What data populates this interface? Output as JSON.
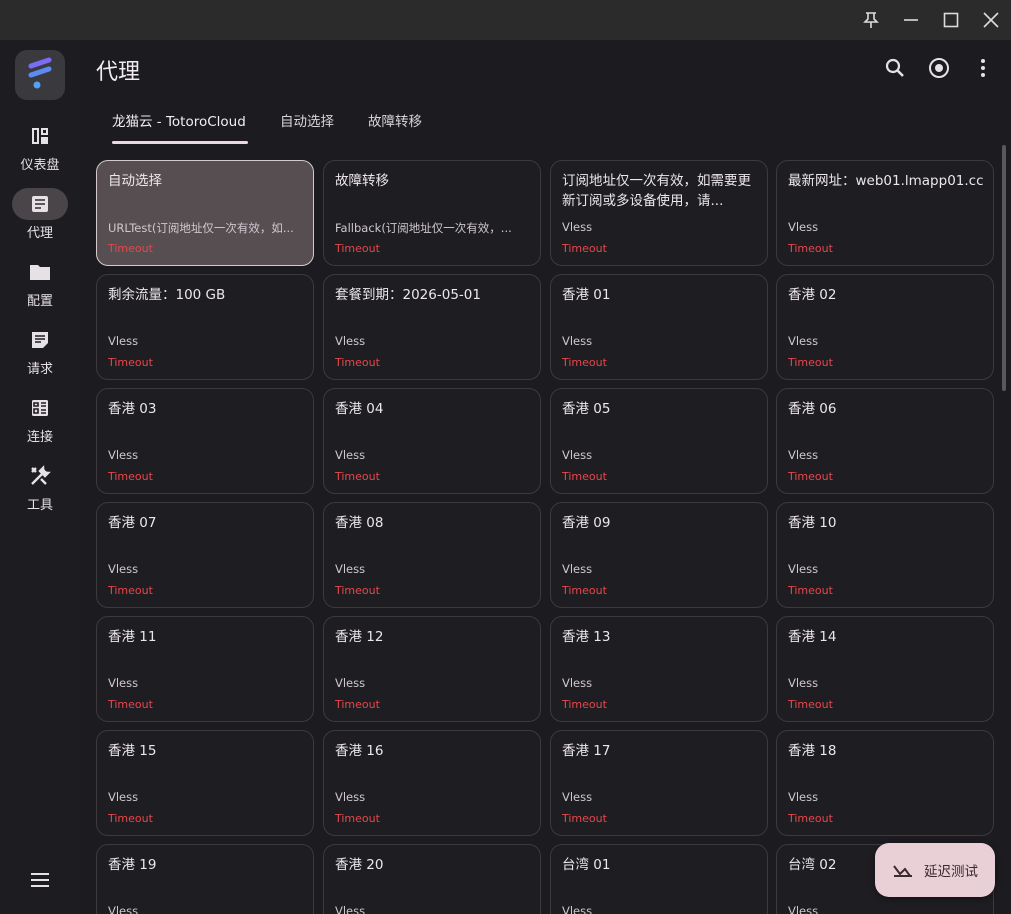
{
  "window": {
    "pin_icon": "pin-icon",
    "minimize_icon": "minimize-icon",
    "maximize_icon": "maximize-icon",
    "close_icon": "close-icon"
  },
  "rail": {
    "items": [
      {
        "label": "仪表盘",
        "icon": "dashboard-icon",
        "active": false
      },
      {
        "label": "代理",
        "icon": "proxy-icon",
        "active": true
      },
      {
        "label": "配置",
        "icon": "folder-icon",
        "active": false
      },
      {
        "label": "请求",
        "icon": "request-icon",
        "active": false
      },
      {
        "label": "连接",
        "icon": "connection-icon",
        "active": false
      },
      {
        "label": "工具",
        "icon": "tools-icon",
        "active": false
      }
    ],
    "menu_icon": "menu-icon"
  },
  "header": {
    "title": "代理",
    "icons": [
      "search-icon",
      "target-icon",
      "more-vert-icon"
    ]
  },
  "tabs": [
    {
      "label": "龙猫云 - TotoroCloud",
      "active": true
    },
    {
      "label": "自动选择",
      "active": false
    },
    {
      "label": "故障转移",
      "active": false
    }
  ],
  "cards": [
    {
      "name": "自动选择",
      "type": "URLTest(订阅地址仅一次有效，如...",
      "delay": "Timeout",
      "selected": true
    },
    {
      "name": "故障转移",
      "type": "Fallback(订阅地址仅一次有效，...",
      "delay": "Timeout"
    },
    {
      "name": "订阅地址仅一次有效，如需要更新订阅或多设备使用，请...",
      "type": "Vless",
      "delay": "Timeout"
    },
    {
      "name": "最新网址：web01.lmapp01.cc",
      "type": "Vless",
      "delay": "Timeout"
    },
    {
      "name": "剩余流量：100 GB",
      "type": "Vless",
      "delay": "Timeout"
    },
    {
      "name": "套餐到期：2026-05-01",
      "type": "Vless",
      "delay": "Timeout"
    },
    {
      "name": "香港 01",
      "type": "Vless",
      "delay": "Timeout"
    },
    {
      "name": "香港 02",
      "type": "Vless",
      "delay": "Timeout"
    },
    {
      "name": "香港 03",
      "type": "Vless",
      "delay": "Timeout"
    },
    {
      "name": "香港 04",
      "type": "Vless",
      "delay": "Timeout"
    },
    {
      "name": "香港 05",
      "type": "Vless",
      "delay": "Timeout"
    },
    {
      "name": "香港 06",
      "type": "Vless",
      "delay": "Timeout"
    },
    {
      "name": "香港 07",
      "type": "Vless",
      "delay": "Timeout"
    },
    {
      "name": "香港 08",
      "type": "Vless",
      "delay": "Timeout"
    },
    {
      "name": "香港 09",
      "type": "Vless",
      "delay": "Timeout"
    },
    {
      "name": "香港 10",
      "type": "Vless",
      "delay": "Timeout"
    },
    {
      "name": "香港 11",
      "type": "Vless",
      "delay": "Timeout"
    },
    {
      "name": "香港 12",
      "type": "Vless",
      "delay": "Timeout"
    },
    {
      "name": "香港 13",
      "type": "Vless",
      "delay": "Timeout"
    },
    {
      "name": "香港 14",
      "type": "Vless",
      "delay": "Timeout"
    },
    {
      "name": "香港 15",
      "type": "Vless",
      "delay": "Timeout"
    },
    {
      "name": "香港 16",
      "type": "Vless",
      "delay": "Timeout"
    },
    {
      "name": "香港 17",
      "type": "Vless",
      "delay": "Timeout"
    },
    {
      "name": "香港 18",
      "type": "Vless",
      "delay": "Timeout"
    },
    {
      "name": "香港 19",
      "type": "Vless",
      "delay": ""
    },
    {
      "name": "香港 20",
      "type": "Vless",
      "delay": ""
    },
    {
      "name": "台湾 01",
      "type": "Vless",
      "delay": ""
    },
    {
      "name": "台湾 02",
      "type": "Vless",
      "delay": ""
    }
  ],
  "fab": {
    "label": "延迟测试",
    "icon": "speed-test-icon"
  },
  "colors": {
    "accent": "#e9cfd6",
    "timeout": "#e5484d",
    "selected_card": "#574e51",
    "background": "#1c1b1f"
  }
}
